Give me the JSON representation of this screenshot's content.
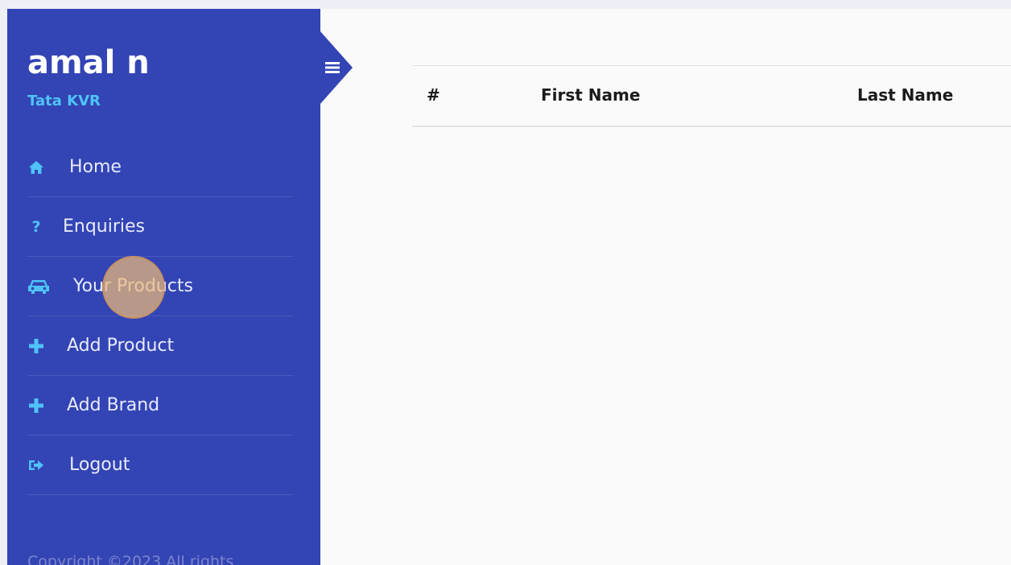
{
  "sidebar": {
    "user_name": "amal n",
    "user_subtitle": "Tata KVR",
    "items": [
      {
        "label": "Home",
        "icon": "home-icon"
      },
      {
        "label": "Enquiries",
        "icon": "question-icon"
      },
      {
        "label": "Your Products",
        "icon": "car-icon"
      },
      {
        "label": "Add Product",
        "icon": "plus-icon"
      },
      {
        "label": "Add Brand",
        "icon": "plus-icon"
      },
      {
        "label": "Logout",
        "icon": "logout-icon"
      }
    ],
    "copyright": "Copyright ©2023 All rights"
  },
  "table": {
    "headers": [
      "#",
      "First Name",
      "Last Name"
    ]
  },
  "colors": {
    "sidebar_bg": "#3344b4",
    "accent": "#4fc3f7",
    "content_bg": "#fafafa"
  }
}
